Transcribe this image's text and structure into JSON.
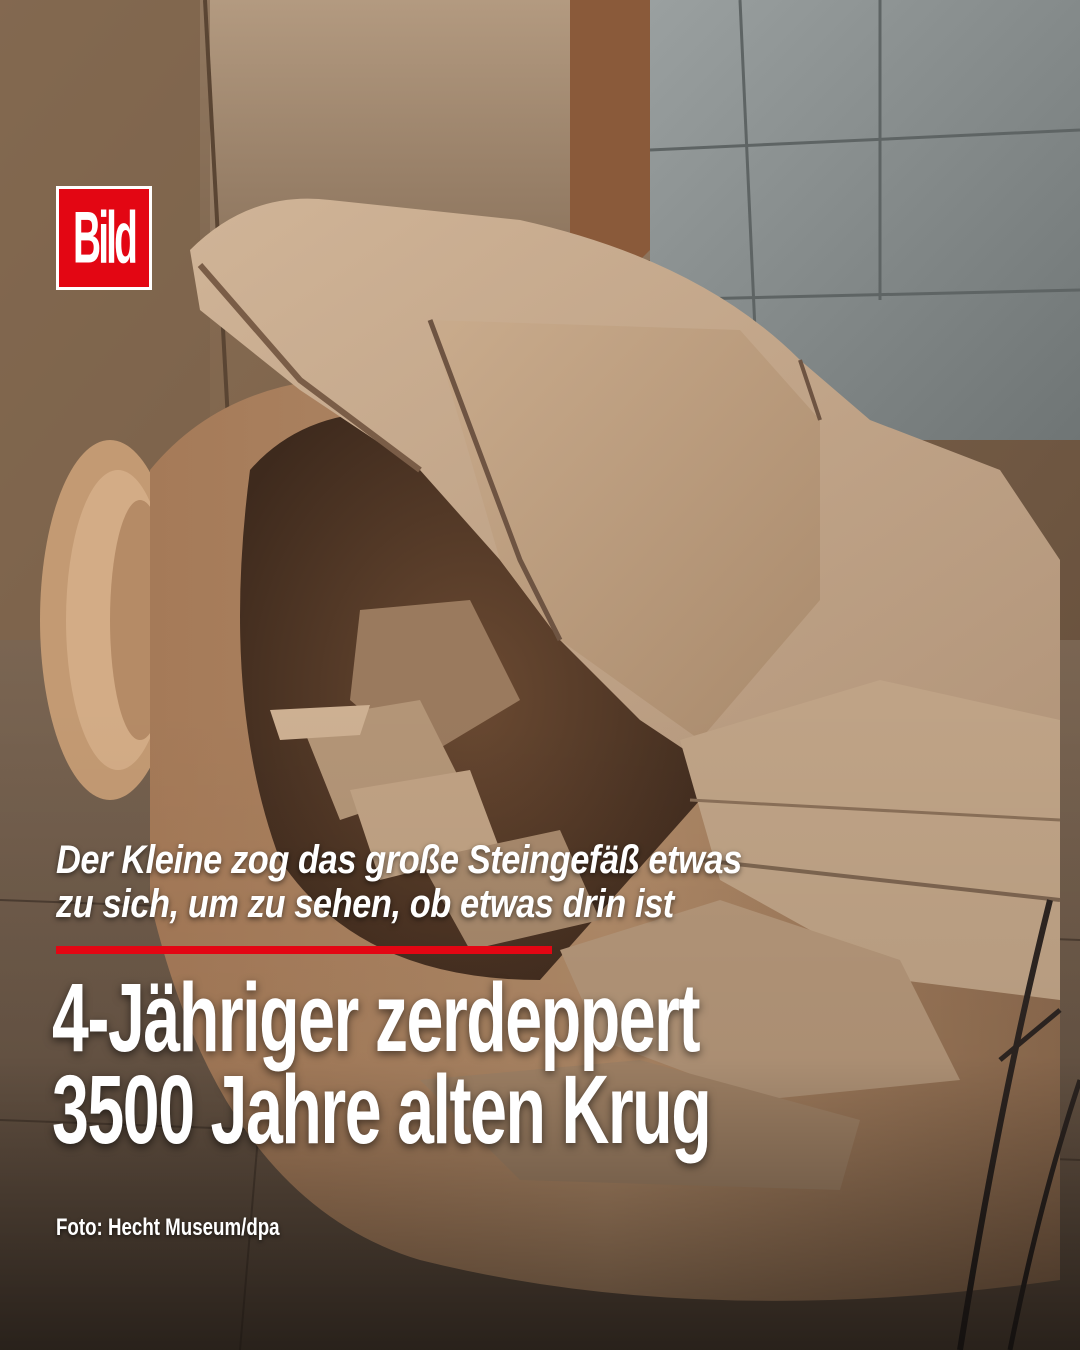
{
  "brand": {
    "logo_text": "Bild",
    "color": "#e30613"
  },
  "subheadline": {
    "line1": "Der Kleine zog das große Steingefäß etwas",
    "line2": "zu sich, um zu sehen, ob etwas drin ist"
  },
  "headline": {
    "line1": "4-Jähriger zerdeppert",
    "line2": "3500 Jahre alten Krug"
  },
  "credit": "Foto: Hecht Museum/dpa",
  "photo": {
    "subject": "broken-clay-jar-icon"
  }
}
